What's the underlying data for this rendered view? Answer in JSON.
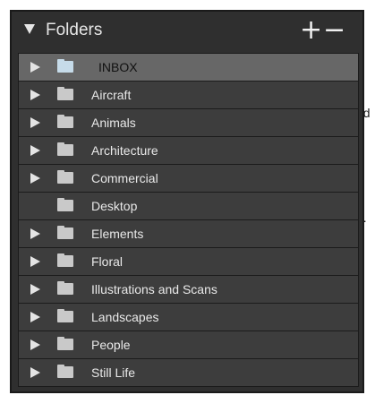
{
  "background_fragments": [
    "ed",
    "n."
  ],
  "folders_panel": {
    "title": "Folders",
    "add_label": "+",
    "remove_label": "−",
    "items": [
      {
        "label": "INBOX",
        "has_children": true,
        "selected": true
      },
      {
        "label": "Aircraft",
        "has_children": true
      },
      {
        "label": "Animals",
        "has_children": true
      },
      {
        "label": "Architecture",
        "has_children": true
      },
      {
        "label": "Commercial",
        "has_children": true
      },
      {
        "label": "Desktop",
        "has_children": false
      },
      {
        "label": "Elements",
        "has_children": true
      },
      {
        "label": "Floral",
        "has_children": true
      },
      {
        "label": "Illustrations and Scans",
        "has_children": true
      },
      {
        "label": "Landscapes",
        "has_children": true
      },
      {
        "label": "People",
        "has_children": true
      },
      {
        "label": "Still Life",
        "has_children": true
      }
    ]
  },
  "colors": {
    "panel_bg": "#2f2f2f",
    "row_bg": "#3d3d3d",
    "selected_row_bg": "#676767",
    "text": "#e9e9e9"
  }
}
